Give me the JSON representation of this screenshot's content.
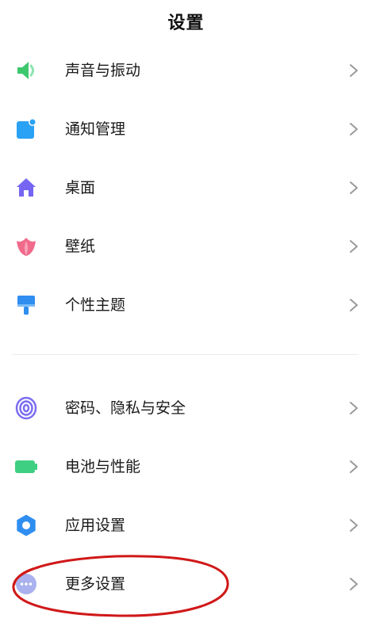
{
  "header": {
    "title": "设置"
  },
  "colors": {
    "sound": "#3ec86e",
    "notifications": "#29a2f5",
    "home": "#7565f2",
    "wallpaper": "#f06a8c",
    "themes": "#2f8ef0",
    "privacy": "#7c6df0",
    "battery": "#3ecf83",
    "apps": "#2f8ef0",
    "more": "#a9b2ee",
    "annotation_circle": "#d01818",
    "chevron": "#9a9a9a"
  },
  "groups": [
    {
      "items": [
        {
          "label": "声音与振动",
          "icon": "speaker-icon"
        },
        {
          "label": "通知管理",
          "icon": "notification-icon"
        },
        {
          "label": "桌面",
          "icon": "home-icon"
        },
        {
          "label": "壁纸",
          "icon": "tulip-icon"
        },
        {
          "label": "个性主题",
          "icon": "paint-brush-icon"
        }
      ]
    },
    {
      "items": [
        {
          "label": "密码、隐私与安全",
          "icon": "fingerprint-icon"
        },
        {
          "label": "电池与性能",
          "icon": "battery-icon"
        },
        {
          "label": "应用设置",
          "icon": "gear-icon"
        },
        {
          "label": "更多设置",
          "icon": "more-dots-icon"
        }
      ]
    }
  ]
}
